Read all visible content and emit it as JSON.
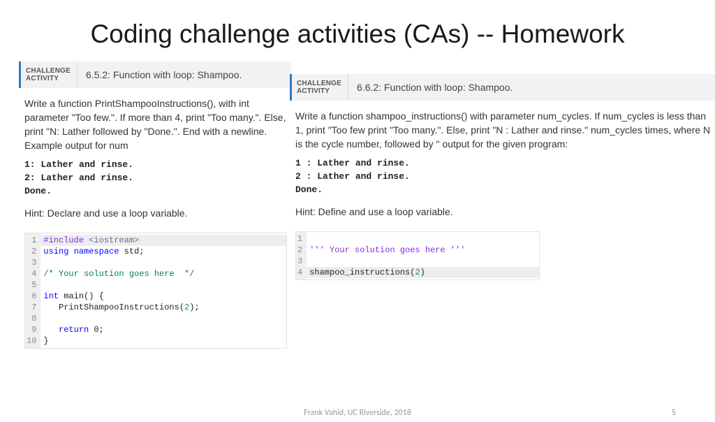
{
  "title": "Coding challenge activities (CAs) -- Homework",
  "left": {
    "badge1": "CHALLENGE",
    "badge2": "ACTIVITY",
    "header": "6.5.2: Function with loop: Shampoo.",
    "prompt": "Write a function PrintShampooInstructions(), with int parameter \"Too few.\". If more than 4, print \"Too many.\". Else, print \"N: Lather followed by \"Done.\". End with a newline. Example output for num",
    "out1": "1: Lather and rinse.",
    "out2": "2: Lather and rinse.",
    "out3": "Done.",
    "hint": "Hint: Declare and use a loop variable.",
    "code": {
      "line_count": 10,
      "l1a": "#include",
      "l1b": " <iostream>",
      "l2a": "using",
      "l2b": " namespace",
      "l2c": " std;",
      "l3": "",
      "l4": "/* Your solution goes here  */",
      "l5": "",
      "l6a": "int",
      "l6b": " main() {",
      "l7a": "   PrintShampooInstructions(",
      "l7b": "2",
      "l7c": ");",
      "l8": "",
      "l9a": "   ",
      "l9b": "return",
      "l9c": " 0;",
      "l10": "}"
    }
  },
  "right": {
    "badge1": "CHALLENGE",
    "badge2": "ACTIVITY",
    "header": "6.6.2: Function with loop: Shampoo.",
    "prompt": "Write a function shampoo_instructions() with parameter num_cycles. If num_cycles is less than 1, print \"Too few print \"Too many.\". Else, print \"N : Lather and rinse.\" num_cycles times, where N is the cycle number, followed by \" output for the given program:",
    "out1": "1 : Lather and rinse.",
    "out2": "2 : Lather and rinse.",
    "out3": "Done.",
    "hint": "Hint: Define and use a loop variable.",
    "code": {
      "line_count": 4,
      "l1": "",
      "l2": "''' Your solution goes here '''",
      "l3": "",
      "l4a": "shampoo_instructions(",
      "l4b": "2",
      "l4c": ")"
    }
  },
  "footer": "Frank Vahid, UC Riverside, 2018",
  "pagenum": "5"
}
